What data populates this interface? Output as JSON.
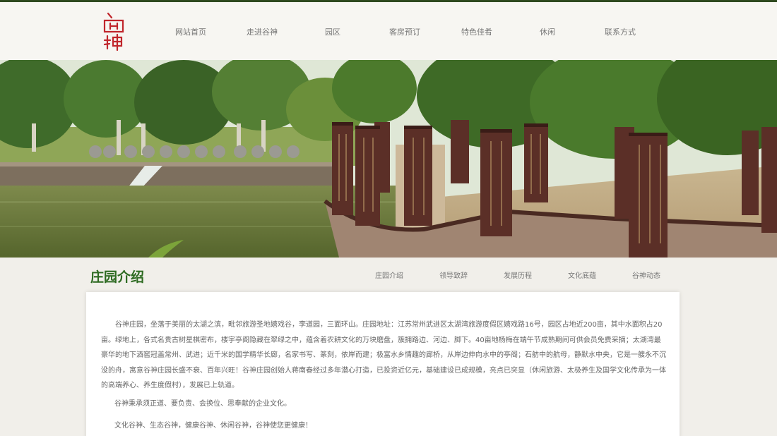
{
  "logo": {
    "seal_text": "谷神",
    "seal_color": "#c0262c"
  },
  "nav": {
    "items": [
      "网站首页",
      "走进谷神",
      "园区",
      "客房预订",
      "特色佳肴",
      "休闲",
      "联系方式"
    ]
  },
  "hero": {
    "description": "garden photo with lake and stone inscription steles",
    "colors": {
      "sky": "#dfe7d6",
      "tree": "#3f6b2a",
      "water": "#6a7a3a",
      "stele": "#5b2f27",
      "stone_wall": "#a08572"
    }
  },
  "section": {
    "title": "庄园介绍",
    "subnav": [
      "庄园介绍",
      "领导致辞",
      "发展历程",
      "文化底蕴",
      "谷神动态"
    ]
  },
  "content": {
    "paragraph1_lines": [
      "谷神庄园，坐落于美丽的太湖之滨，毗邻旅游圣地嬉戏谷，李道园，三面环山。庄园地址：江苏常州武进区太湖湾旅游度假区嬉戏路16号，园区占地近200亩，其中水面积占20亩。",
      "绿地上，各式名贵古树星棋密布，楼宇亭阁隐藏在翠绿之中，蕴含着农耕文化的万块磨盘，簇拥路边、河边、脚下。40亩地杨梅在端午节成熟期间可供会员免费采摘；太湖湾最豪华的地",
      "下酒窖冠盖常州、武进；近千米的国学精华长廊，名家书写、篆刻，依岸而建；极富水乡情趣的廊桥，从岸边伸向水中的亭阁；石舫中的航母，静默水中央，它是一艘永不沉没的舟，寓",
      "意谷神庄园长盛不衰、百年兴旺！谷神庄园创始人蒋南春经过多年潜心打造，已投资近亿元，基础建设已成规模，亮点已突显（休闲旅游、太极养生及国学文化传承为一体的高端养心、",
      "养生度假村），发展已上轨道。"
    ],
    "paragraph2": "谷神秉承须正道、要负责、会换位、思奉献的企业文化。",
    "paragraph3": "文化谷神、生态谷神，健康谷神、休闲谷神，谷神使您更健康！"
  }
}
